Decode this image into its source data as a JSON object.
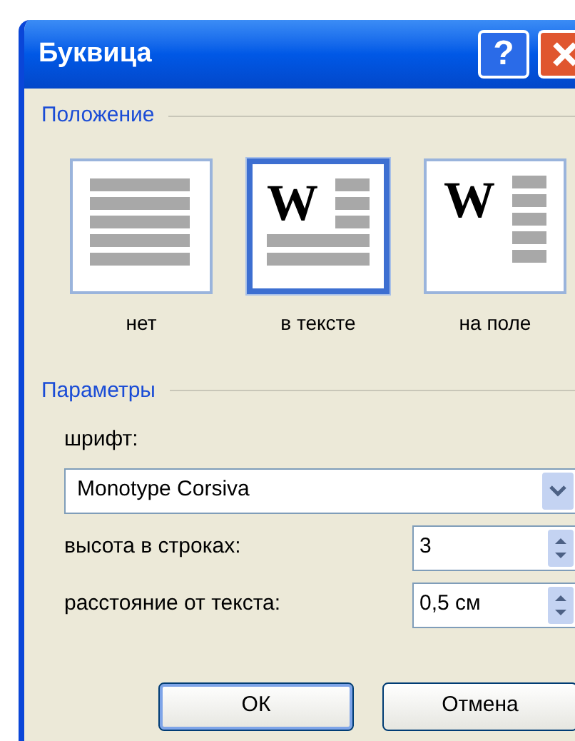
{
  "window": {
    "title": "Буквица",
    "help": "?"
  },
  "position": {
    "legend": "Положение",
    "options": [
      {
        "label": "нет",
        "kind": "none",
        "selected": false
      },
      {
        "label": "в тексте",
        "kind": "dropped",
        "letter": "W",
        "selected": true
      },
      {
        "label": "на поле",
        "kind": "margin",
        "letter": "W",
        "selected": false
      }
    ]
  },
  "parameters": {
    "legend": "Параметры",
    "font": {
      "label": "шрифт:",
      "value": "Monotype Corsiva"
    },
    "lines": {
      "label": "высота в строках:",
      "value": "3"
    },
    "distance": {
      "label": "расстояние от текста:",
      "value": "0,5 см"
    }
  },
  "buttons": [
    {
      "label": "ОК",
      "default": true
    },
    {
      "label": "Отмена",
      "default": false
    }
  ]
}
